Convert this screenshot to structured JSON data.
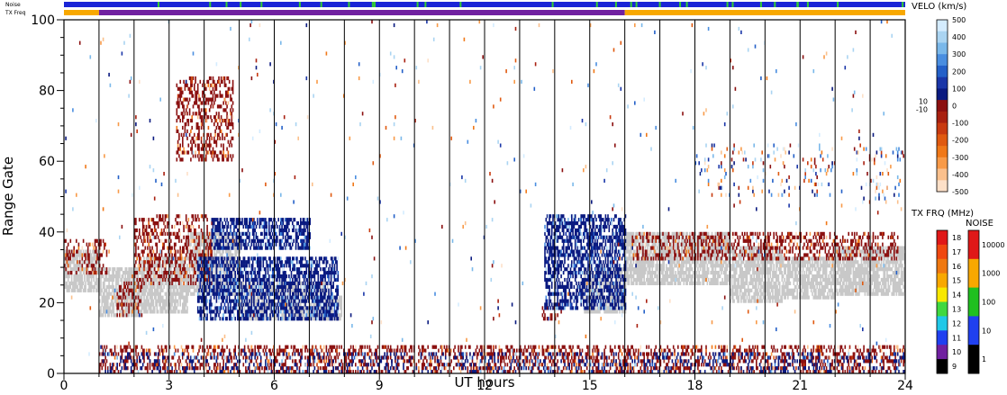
{
  "strip_labels": {
    "noise": "Noise",
    "tx_freq": "TX Freq"
  },
  "chart_data": {
    "type": "heatmap",
    "xlabel": "UT hours",
    "ylabel": "Range Gate",
    "xlim": [
      0,
      24
    ],
    "ylim": [
      0,
      100
    ],
    "xticks": [
      0,
      3,
      6,
      9,
      12,
      15,
      18,
      21,
      24
    ],
    "yticks": [
      0,
      20,
      40,
      60,
      80,
      100
    ],
    "grid": "vertical lines every hour",
    "ground_scatter_color": "#c8c8c8",
    "regions": [
      {
        "kind": "ground",
        "x": [
          0.0,
          1.0
        ],
        "y": [
          23,
          35
        ]
      },
      {
        "kind": "ground",
        "x": [
          1.0,
          2.2
        ],
        "y": [
          16,
          30
        ]
      },
      {
        "kind": "ground",
        "x": [
          2.2,
          3.5
        ],
        "y": [
          17,
          33
        ]
      },
      {
        "kind": "ground",
        "x": [
          3.5,
          5.0
        ],
        "y": [
          22,
          40
        ]
      },
      {
        "kind": "ground",
        "x": [
          5.0,
          7.5
        ],
        "y": [
          15,
          26
        ]
      },
      {
        "kind": "ground",
        "x": [
          7.5,
          7.9
        ],
        "y": [
          15,
          22
        ]
      },
      {
        "kind": "ground",
        "x": [
          14.8,
          16.0
        ],
        "y": [
          17,
          30
        ]
      },
      {
        "kind": "ground",
        "x": [
          16.0,
          19.0
        ],
        "y": [
          25,
          40
        ]
      },
      {
        "kind": "ground",
        "x": [
          19.0,
          20.5
        ],
        "y": [
          20,
          36
        ]
      },
      {
        "kind": "ground",
        "x": [
          20.5,
          22.0
        ],
        "y": [
          21,
          33
        ]
      },
      {
        "kind": "ground",
        "x": [
          22.0,
          24.0
        ],
        "y": [
          22,
          36
        ]
      },
      {
        "kind": "neg",
        "x": [
          0.0,
          1.2
        ],
        "y": [
          28,
          38
        ]
      },
      {
        "kind": "neg",
        "x": [
          1.5,
          2.2
        ],
        "y": [
          16,
          26
        ]
      },
      {
        "kind": "neg",
        "x": [
          2.0,
          4.2
        ],
        "y": [
          25,
          45
        ]
      },
      {
        "kind": "neg",
        "x": [
          3.2,
          4.8
        ],
        "y": [
          60,
          84
        ]
      },
      {
        "kind": "neg",
        "x": [
          13.6,
          14.2
        ],
        "y": [
          15,
          20
        ]
      },
      {
        "kind": "neg",
        "x": [
          1.0,
          24.0
        ],
        "y": [
          0,
          8
        ]
      },
      {
        "kind": "neg",
        "x": [
          16.2,
          23.8
        ],
        "y": [
          32,
          40
        ]
      },
      {
        "kind": "pos",
        "x": [
          3.8,
          7.8
        ],
        "y": [
          15,
          33
        ]
      },
      {
        "kind": "pos",
        "x": [
          4.2,
          7.0
        ],
        "y": [
          35,
          44
        ]
      },
      {
        "kind": "pos",
        "x": [
          13.7,
          16.0
        ],
        "y": [
          18,
          45
        ]
      },
      {
        "kind": "pos",
        "x": [
          1.0,
          24.0
        ],
        "y": [
          0,
          6
        ]
      },
      {
        "kind": "scatter",
        "x": [
          0.0,
          24.0
        ],
        "y": [
          0,
          100
        ]
      },
      {
        "kind": "scatter",
        "x": [
          18.0,
          22.0
        ],
        "y": [
          50,
          65
        ]
      },
      {
        "kind": "scatter",
        "x": [
          22.5,
          24.0
        ],
        "y": [
          48,
          64
        ]
      }
    ],
    "noise_strip": {
      "color": "#1a24d6",
      "accent": "#33cc33"
    },
    "freq_strip": [
      {
        "x": [
          0.0,
          1.0
        ],
        "level": "15"
      },
      {
        "x": [
          1.0,
          16.0
        ],
        "level": "10"
      },
      {
        "x": [
          16.0,
          24.0
        ],
        "level": "15"
      }
    ]
  },
  "velocity_colorbar": {
    "title": "VELO (km/s)",
    "ticks": [
      "500",
      "400",
      "300",
      "200",
      "100",
      "0",
      "-100",
      "-200",
      "-300",
      "-400",
      "-500"
    ],
    "near_zero": [
      "10",
      "-10"
    ],
    "colors": [
      "#d4ecff",
      "#aad4f2",
      "#7ab8ea",
      "#4a8ee0",
      "#2460c8",
      "#1a36a8",
      "#0a1a80",
      "#8b1010",
      "#a82010",
      "#c83a10",
      "#e05a10",
      "#f07818",
      "#f89a48",
      "#fbc08c",
      "#fde0c8"
    ]
  },
  "freq_colorbar": {
    "title": "TX FRQ (MHz)",
    "labels": [
      "18",
      "17",
      "16",
      "15",
      "14",
      "13",
      "12",
      "11",
      "10",
      "9"
    ],
    "colors": [
      "#e01818",
      "#f04810",
      "#f07810",
      "#f8a800",
      "#f8e800",
      "#40d840",
      "#20c8e8",
      "#2040f0",
      "#7020a0",
      "#000000"
    ]
  },
  "noise_colorbar": {
    "title": "NOISE",
    "labels": [
      "10000",
      "1000",
      "100",
      "10",
      "1"
    ],
    "colors": [
      "#e01818",
      "#f8a800",
      "#20c020",
      "#2040f0",
      "#000000"
    ]
  }
}
